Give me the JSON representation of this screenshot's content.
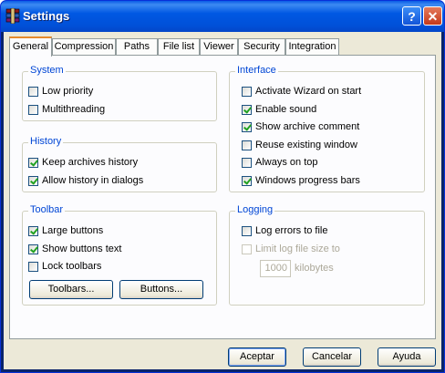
{
  "window": {
    "title": "Settings",
    "help_label": "?",
    "close_label": "✕"
  },
  "tabs": [
    "General",
    "Compression",
    "Paths",
    "File list",
    "Viewer",
    "Security",
    "Integration"
  ],
  "system": {
    "label": "System",
    "items": [
      {
        "label": "Low priority",
        "checked": false
      },
      {
        "label": "Multithreading",
        "checked": false
      }
    ]
  },
  "history": {
    "label": "History",
    "items": [
      {
        "label": "Keep archives history",
        "checked": true
      },
      {
        "label": "Allow history in dialogs",
        "checked": true
      }
    ]
  },
  "toolbar": {
    "label": "Toolbar",
    "items": [
      {
        "label": "Large buttons",
        "checked": true
      },
      {
        "label": "Show buttons text",
        "checked": true
      },
      {
        "label": "Lock toolbars",
        "checked": false
      }
    ],
    "toolbars_button": "Toolbars...",
    "buttons_button": "Buttons..."
  },
  "interface": {
    "label": "Interface",
    "items": [
      {
        "label": "Activate Wizard on start",
        "checked": false
      },
      {
        "label": "Enable sound",
        "checked": true
      },
      {
        "label": "Show archive comment",
        "checked": true
      },
      {
        "label": "Reuse existing window",
        "checked": false
      },
      {
        "label": "Always on top",
        "checked": false
      },
      {
        "label": "Windows progress bars",
        "checked": true
      }
    ]
  },
  "logging": {
    "label": "Logging",
    "log_errors": {
      "label": "Log errors to file",
      "checked": false
    },
    "limit_size": {
      "label": "Limit log file size to",
      "checked": false
    },
    "size_value": "1000",
    "size_unit": "kilobytes"
  },
  "footer": {
    "ok": "Aceptar",
    "cancel": "Cancelar",
    "help": "Ayuda"
  }
}
